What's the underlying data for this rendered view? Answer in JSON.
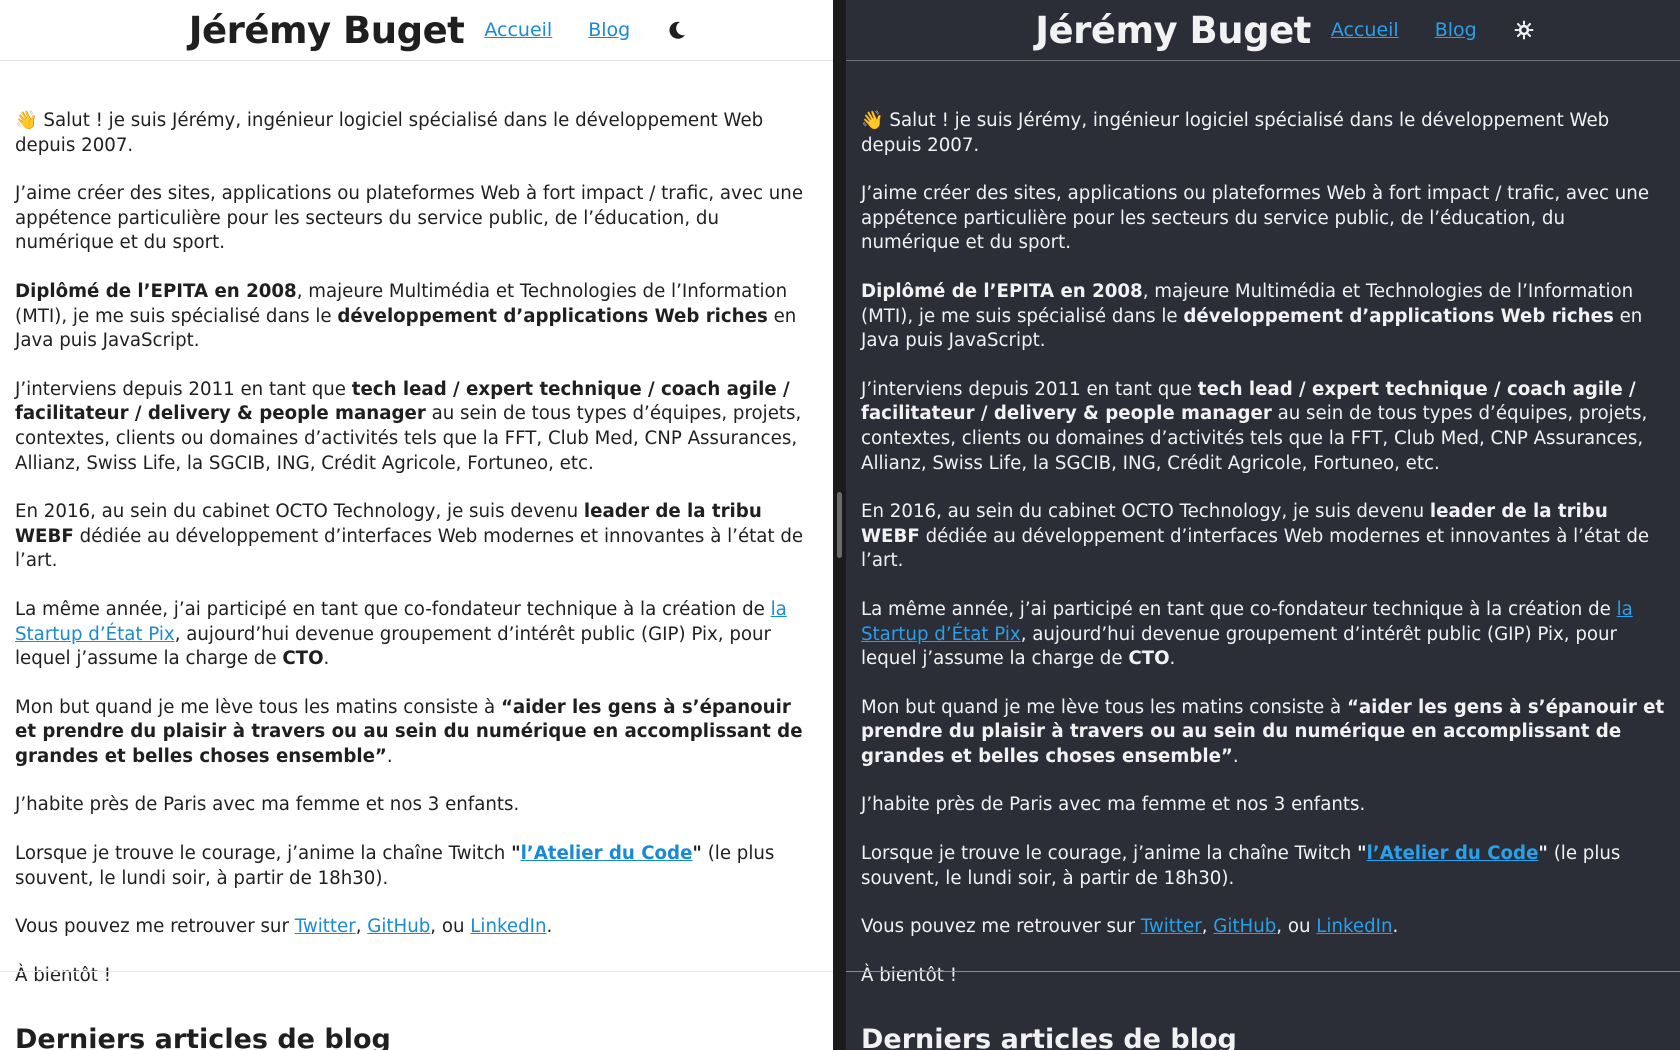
{
  "header": {
    "site_title": "Jérémy Buget",
    "nav_home": "Accueil",
    "nav_blog": "Blog",
    "light_toggle_icon": "moon-icon",
    "dark_toggle_icon": "sun-icon"
  },
  "content": {
    "p1": "👋 Salut ! je suis Jérémy, ingénieur logiciel spécialisé dans le développement Web depuis 2007.",
    "p2": "J’aime créer des sites, applications ou plateformes Web à fort impact / trafic, avec une appétence particulière pour les secteurs du service public, de l’éducation, du numérique et du sport.",
    "p3_b1": "Diplômé de l’EPITA en 2008",
    "p3_t1": ", majeure Multimédia et Technologies de l’Information (MTI), je me suis spécialisé dans le ",
    "p3_b2": "développement d’applications Web riches",
    "p3_t2": " en Java puis JavaScript.",
    "p4_t1": "J’interviens depuis 2011 en tant que ",
    "p4_b1": "tech lead / expert technique / coach agile / facilitateur / delivery & people manager",
    "p4_t2": " au sein de tous types d’équipes, projets, contextes, clients ou domaines d’activités tels que la FFT, Club Med, CNP Assurances, Allianz, Swiss Life, la SGCIB, ING, Crédit Agricole, Fortuneo, etc.",
    "p5_t1": "En 2016, au sein du cabinet OCTO Technology, je suis devenu ",
    "p5_b1": "leader de la tribu WEBF",
    "p5_t2": " dédiée au développement d’interfaces Web modernes et innovantes à l’état de l’art.",
    "p6_t1": "La même année, j’ai participé en tant que co-fondateur technique à la création de ",
    "p6_link": "la Startup d’État Pix",
    "p6_t2": ", aujourd’hui devenue groupement d’intérêt public (GIP) Pix, pour lequel j’assume la charge de ",
    "p6_b1": "CTO",
    "p6_t3": ".",
    "p7_t1": "Mon but quand je me lève tous les matins consiste à ",
    "p7_b1": "“aider les gens à s’épanouir et prendre du plaisir à travers ou au sein du numérique en accomplissant de grandes et belles choses ensemble”",
    "p7_t2": ".",
    "p8": "J’habite près de Paris avec ma femme et nos 3 enfants.",
    "p9_t1": "Lorsque je trouve le courage, j’anime la chaîne Twitch ",
    "p9_q1": "\"",
    "p9_link": "l’Atelier du Code",
    "p9_q2": "\"",
    "p9_t2": " (le plus souvent, le lundi soir, à partir de 18h30).",
    "p10_t1": "Vous pouvez me retrouver sur ",
    "p10_twitter": "Twitter",
    "p10_sep1": ", ",
    "p10_github": "GitHub",
    "p10_sep2": ", ou ",
    "p10_linkedin": "LinkedIn",
    "p10_t2": ".",
    "p11": "À bientôt !"
  },
  "blog_section": {
    "title": "Derniers articles de blog"
  },
  "colors": {
    "light_bg": "#ffffff",
    "dark_bg": "#2b2d37",
    "link": "#1a8ad6"
  }
}
